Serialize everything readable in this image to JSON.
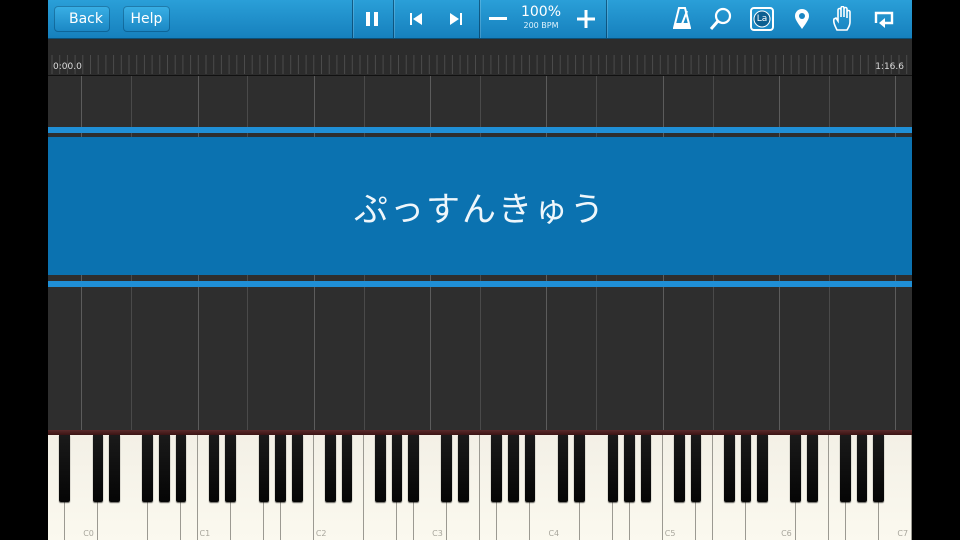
{
  "toolbar": {
    "back_label": "Back",
    "help_label": "Help",
    "speed_percent": "100%",
    "speed_bpm": "200 BPM",
    "icons": [
      "pause-icon",
      "skip-back-icon",
      "skip-forward-icon",
      "minus-icon",
      "plus-icon",
      "metronome-icon",
      "search-icon",
      "note-label-icon",
      "marker-icon",
      "hand-icon",
      "loop-icon"
    ],
    "note_label_text": "La"
  },
  "timeline": {
    "start_time": "0:00.0",
    "end_time": "1:16.6"
  },
  "banner": {
    "title": "ぷっすんきゅう"
  },
  "keyboard": {
    "octave_labels": [
      "C0",
      "C1",
      "C2",
      "C3",
      "C4",
      "C5",
      "C6",
      "C7"
    ],
    "white_key_count": 52,
    "colors": {
      "accent": "#1f8fd6",
      "banner": "#0b72b0",
      "toolbar": "#1a88c6"
    }
  }
}
